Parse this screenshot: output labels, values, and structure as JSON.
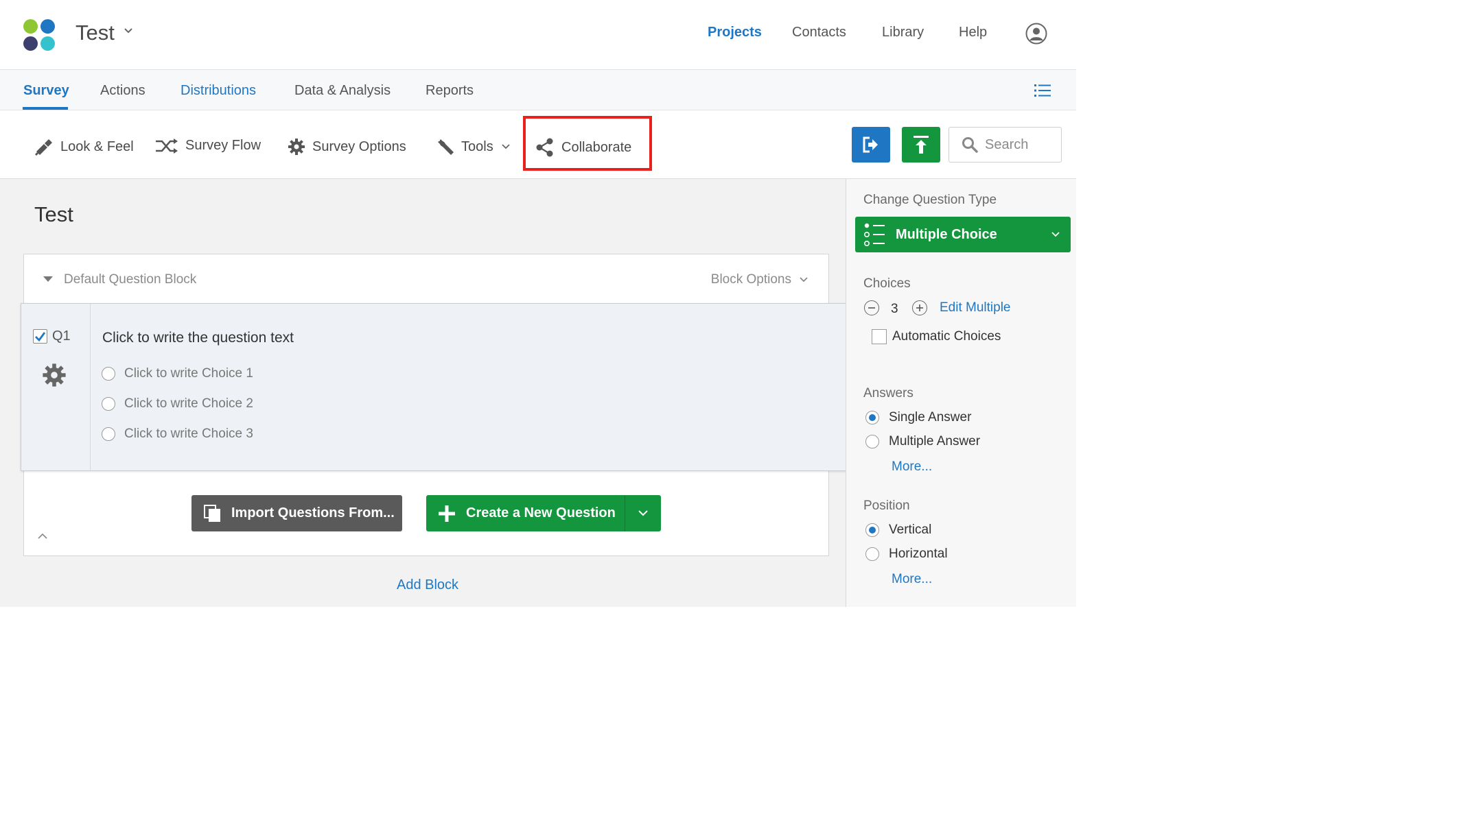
{
  "header": {
    "project_name": "Test",
    "nav": [
      "Projects",
      "Contacts",
      "Library",
      "Help"
    ],
    "active_nav": "Projects"
  },
  "tabs": [
    "Survey",
    "Actions",
    "Distributions",
    "Data & Analysis",
    "Reports"
  ],
  "active_tab": "Survey",
  "toolbar": {
    "look_feel": "Look & Feel",
    "survey_flow": "Survey Flow",
    "survey_options": "Survey Options",
    "tools": "Tools",
    "collaborate": "Collaborate",
    "search_placeholder": "Search"
  },
  "survey": {
    "title": "Test",
    "block_title": "Default Question Block",
    "block_options": "Block Options",
    "question": {
      "label": "Q1",
      "text": "Click to write the question text",
      "choices": [
        "Click to write Choice 1",
        "Click to write Choice 2",
        "Click to write Choice 3"
      ]
    },
    "import_label": "Import Questions From...",
    "create_label": "Create a New Question",
    "add_block": "Add Block"
  },
  "panel": {
    "change_type_heading": "Change Question Type",
    "question_type": "Multiple Choice",
    "choices_heading": "Choices",
    "choices_count": "3",
    "edit_multiple": "Edit Multiple",
    "automatic_choices": "Automatic Choices",
    "answers_heading": "Answers",
    "answers": [
      "Single Answer",
      "Multiple Answer"
    ],
    "answers_more": "More...",
    "position_heading": "Position",
    "positions": [
      "Vertical",
      "Horizontal"
    ],
    "position_more": "More..."
  },
  "colors": {
    "accent_blue": "#1f77c3",
    "green": "#13963d",
    "highlight_red": "#e8211c"
  }
}
